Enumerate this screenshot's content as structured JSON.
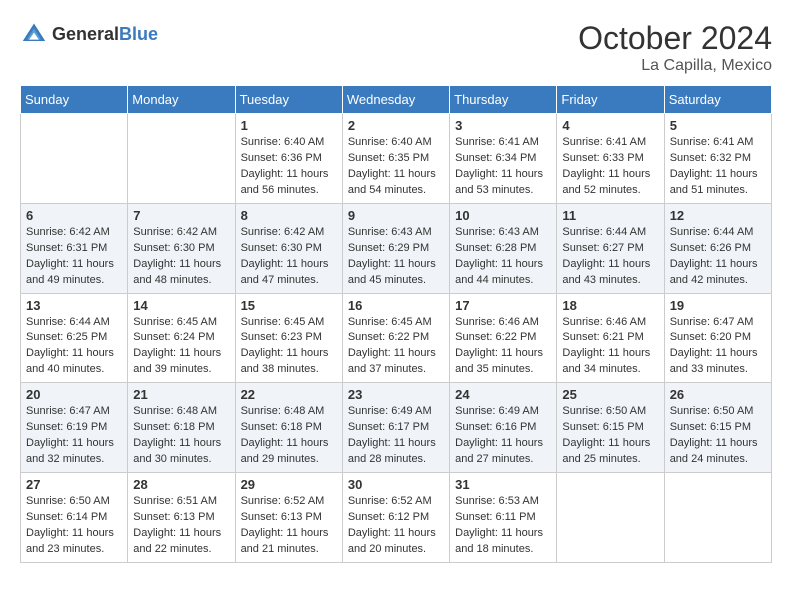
{
  "header": {
    "logo_general": "General",
    "logo_blue": "Blue",
    "month_year": "October 2024",
    "location": "La Capilla, Mexico"
  },
  "weekdays": [
    "Sunday",
    "Monday",
    "Tuesday",
    "Wednesday",
    "Thursday",
    "Friday",
    "Saturday"
  ],
  "weeks": [
    [
      {
        "day": "",
        "sunrise": "",
        "sunset": "",
        "daylight": ""
      },
      {
        "day": "",
        "sunrise": "",
        "sunset": "",
        "daylight": ""
      },
      {
        "day": "1",
        "sunrise": "Sunrise: 6:40 AM",
        "sunset": "Sunset: 6:36 PM",
        "daylight": "Daylight: 11 hours and 56 minutes."
      },
      {
        "day": "2",
        "sunrise": "Sunrise: 6:40 AM",
        "sunset": "Sunset: 6:35 PM",
        "daylight": "Daylight: 11 hours and 54 minutes."
      },
      {
        "day": "3",
        "sunrise": "Sunrise: 6:41 AM",
        "sunset": "Sunset: 6:34 PM",
        "daylight": "Daylight: 11 hours and 53 minutes."
      },
      {
        "day": "4",
        "sunrise": "Sunrise: 6:41 AM",
        "sunset": "Sunset: 6:33 PM",
        "daylight": "Daylight: 11 hours and 52 minutes."
      },
      {
        "day": "5",
        "sunrise": "Sunrise: 6:41 AM",
        "sunset": "Sunset: 6:32 PM",
        "daylight": "Daylight: 11 hours and 51 minutes."
      }
    ],
    [
      {
        "day": "6",
        "sunrise": "Sunrise: 6:42 AM",
        "sunset": "Sunset: 6:31 PM",
        "daylight": "Daylight: 11 hours and 49 minutes."
      },
      {
        "day": "7",
        "sunrise": "Sunrise: 6:42 AM",
        "sunset": "Sunset: 6:30 PM",
        "daylight": "Daylight: 11 hours and 48 minutes."
      },
      {
        "day": "8",
        "sunrise": "Sunrise: 6:42 AM",
        "sunset": "Sunset: 6:30 PM",
        "daylight": "Daylight: 11 hours and 47 minutes."
      },
      {
        "day": "9",
        "sunrise": "Sunrise: 6:43 AM",
        "sunset": "Sunset: 6:29 PM",
        "daylight": "Daylight: 11 hours and 45 minutes."
      },
      {
        "day": "10",
        "sunrise": "Sunrise: 6:43 AM",
        "sunset": "Sunset: 6:28 PM",
        "daylight": "Daylight: 11 hours and 44 minutes."
      },
      {
        "day": "11",
        "sunrise": "Sunrise: 6:44 AM",
        "sunset": "Sunset: 6:27 PM",
        "daylight": "Daylight: 11 hours and 43 minutes."
      },
      {
        "day": "12",
        "sunrise": "Sunrise: 6:44 AM",
        "sunset": "Sunset: 6:26 PM",
        "daylight": "Daylight: 11 hours and 42 minutes."
      }
    ],
    [
      {
        "day": "13",
        "sunrise": "Sunrise: 6:44 AM",
        "sunset": "Sunset: 6:25 PM",
        "daylight": "Daylight: 11 hours and 40 minutes."
      },
      {
        "day": "14",
        "sunrise": "Sunrise: 6:45 AM",
        "sunset": "Sunset: 6:24 PM",
        "daylight": "Daylight: 11 hours and 39 minutes."
      },
      {
        "day": "15",
        "sunrise": "Sunrise: 6:45 AM",
        "sunset": "Sunset: 6:23 PM",
        "daylight": "Daylight: 11 hours and 38 minutes."
      },
      {
        "day": "16",
        "sunrise": "Sunrise: 6:45 AM",
        "sunset": "Sunset: 6:22 PM",
        "daylight": "Daylight: 11 hours and 37 minutes."
      },
      {
        "day": "17",
        "sunrise": "Sunrise: 6:46 AM",
        "sunset": "Sunset: 6:22 PM",
        "daylight": "Daylight: 11 hours and 35 minutes."
      },
      {
        "day": "18",
        "sunrise": "Sunrise: 6:46 AM",
        "sunset": "Sunset: 6:21 PM",
        "daylight": "Daylight: 11 hours and 34 minutes."
      },
      {
        "day": "19",
        "sunrise": "Sunrise: 6:47 AM",
        "sunset": "Sunset: 6:20 PM",
        "daylight": "Daylight: 11 hours and 33 minutes."
      }
    ],
    [
      {
        "day": "20",
        "sunrise": "Sunrise: 6:47 AM",
        "sunset": "Sunset: 6:19 PM",
        "daylight": "Daylight: 11 hours and 32 minutes."
      },
      {
        "day": "21",
        "sunrise": "Sunrise: 6:48 AM",
        "sunset": "Sunset: 6:18 PM",
        "daylight": "Daylight: 11 hours and 30 minutes."
      },
      {
        "day": "22",
        "sunrise": "Sunrise: 6:48 AM",
        "sunset": "Sunset: 6:18 PM",
        "daylight": "Daylight: 11 hours and 29 minutes."
      },
      {
        "day": "23",
        "sunrise": "Sunrise: 6:49 AM",
        "sunset": "Sunset: 6:17 PM",
        "daylight": "Daylight: 11 hours and 28 minutes."
      },
      {
        "day": "24",
        "sunrise": "Sunrise: 6:49 AM",
        "sunset": "Sunset: 6:16 PM",
        "daylight": "Daylight: 11 hours and 27 minutes."
      },
      {
        "day": "25",
        "sunrise": "Sunrise: 6:50 AM",
        "sunset": "Sunset: 6:15 PM",
        "daylight": "Daylight: 11 hours and 25 minutes."
      },
      {
        "day": "26",
        "sunrise": "Sunrise: 6:50 AM",
        "sunset": "Sunset: 6:15 PM",
        "daylight": "Daylight: 11 hours and 24 minutes."
      }
    ],
    [
      {
        "day": "27",
        "sunrise": "Sunrise: 6:50 AM",
        "sunset": "Sunset: 6:14 PM",
        "daylight": "Daylight: 11 hours and 23 minutes."
      },
      {
        "day": "28",
        "sunrise": "Sunrise: 6:51 AM",
        "sunset": "Sunset: 6:13 PM",
        "daylight": "Daylight: 11 hours and 22 minutes."
      },
      {
        "day": "29",
        "sunrise": "Sunrise: 6:52 AM",
        "sunset": "Sunset: 6:13 PM",
        "daylight": "Daylight: 11 hours and 21 minutes."
      },
      {
        "day": "30",
        "sunrise": "Sunrise: 6:52 AM",
        "sunset": "Sunset: 6:12 PM",
        "daylight": "Daylight: 11 hours and 20 minutes."
      },
      {
        "day": "31",
        "sunrise": "Sunrise: 6:53 AM",
        "sunset": "Sunset: 6:11 PM",
        "daylight": "Daylight: 11 hours and 18 minutes."
      },
      {
        "day": "",
        "sunrise": "",
        "sunset": "",
        "daylight": ""
      },
      {
        "day": "",
        "sunrise": "",
        "sunset": "",
        "daylight": ""
      }
    ]
  ]
}
